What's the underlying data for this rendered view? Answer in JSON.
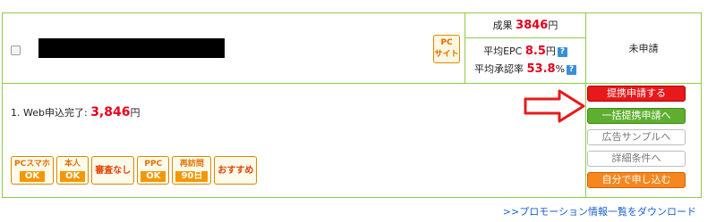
{
  "row": {
    "pc_badge": {
      "line1": "PC",
      "line2": "サイト"
    },
    "stats": {
      "result_label": "成果",
      "result_value": "3846",
      "result_unit": "円",
      "epc_label": "平均EPC",
      "epc_value": "8.5",
      "epc_unit": "円",
      "approval_label": "平均承認率",
      "approval_value": "53.8",
      "approval_unit": "%"
    },
    "status": "未申請",
    "reward": {
      "label": "1. Web申込完了:",
      "value": "3,846",
      "unit": "円"
    },
    "tags": [
      {
        "line1": "PCスマホ",
        "line2": "OK"
      },
      {
        "line1": "本人",
        "line2": "OK"
      },
      {
        "line1": "審査なし",
        "line2": ""
      },
      {
        "line1": "PPC",
        "line2": "OK"
      },
      {
        "line1": "再訪問",
        "line2": "90日"
      },
      {
        "line1": "おすすめ",
        "line2": ""
      }
    ],
    "buttons": {
      "apply": "提携申請する",
      "bulk_apply": "一括提携申請へ",
      "ad_sample": "広告サンプルへ",
      "details": "詳細条件へ",
      "self_apply": "自分で申し込む"
    }
  },
  "footer": {
    "download_link": ">>プロモーション情報一覧をダウンロード"
  },
  "colors": {
    "border_green": "#8fcb45",
    "highlight_red": "#e8001c",
    "apply_red": "#e8191b",
    "bulk_green": "#5fae2f",
    "self_orange": "#f6871f",
    "link_blue": "#1a5fc9"
  }
}
